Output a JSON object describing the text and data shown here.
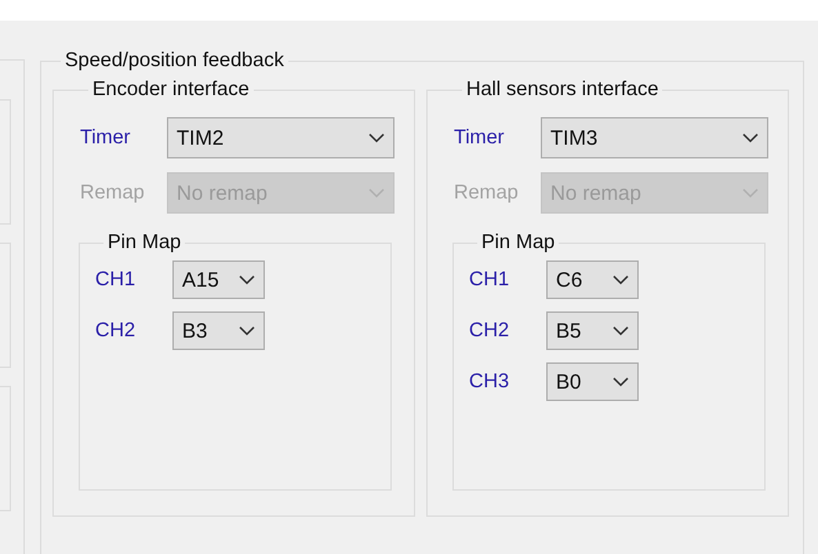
{
  "group": {
    "title": "Speed/position feedback",
    "panels": [
      {
        "title": "Encoder interface",
        "timer": {
          "label": "Timer",
          "value": "TIM2",
          "disabled": false
        },
        "remap": {
          "label": "Remap",
          "value": "No remap",
          "disabled": true
        },
        "pin_map": {
          "title": "Pin Map",
          "channels": [
            {
              "label": "CH1",
              "value": "A15"
            },
            {
              "label": "CH2",
              "value": "B3"
            }
          ]
        }
      },
      {
        "title": "Hall sensors interface",
        "timer": {
          "label": "Timer",
          "value": "TIM3",
          "disabled": false
        },
        "remap": {
          "label": "Remap",
          "value": "No remap",
          "disabled": true
        },
        "pin_map": {
          "title": "Pin Map",
          "channels": [
            {
              "label": "CH1",
              "value": "C6"
            },
            {
              "label": "CH2",
              "value": "B5"
            },
            {
              "label": "CH3",
              "value": "B0"
            }
          ]
        }
      }
    ]
  }
}
